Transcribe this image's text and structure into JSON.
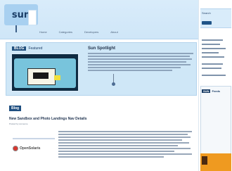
{
  "site": {
    "logo_text": "sun",
    "nav": [
      "Home",
      "Categories",
      "Developers",
      "About"
    ]
  },
  "feature": {
    "title_badge": "BLOG",
    "title_rest": "Featured",
    "heading": "Sun Spotlight"
  },
  "blog": {
    "badge": "Blog",
    "post_title": "New Sandbox and Photo Landings Nav Details",
    "post_meta": "Posted by someone"
  },
  "brand": {
    "name": "OpenSolaris"
  },
  "sidebar": {
    "label": "Search",
    "panel_badge": "SUN",
    "panel_title": "Feeds"
  }
}
